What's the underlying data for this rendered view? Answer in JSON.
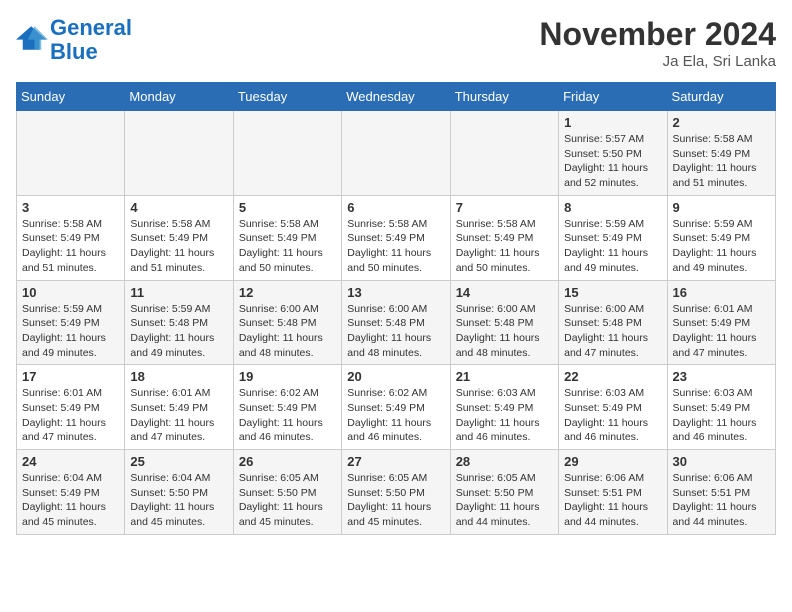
{
  "header": {
    "logo_line1": "General",
    "logo_line2": "Blue",
    "month": "November 2024",
    "location": "Ja Ela, Sri Lanka"
  },
  "weekdays": [
    "Sunday",
    "Monday",
    "Tuesday",
    "Wednesday",
    "Thursday",
    "Friday",
    "Saturday"
  ],
  "weeks": [
    [
      {
        "day": "",
        "info": ""
      },
      {
        "day": "",
        "info": ""
      },
      {
        "day": "",
        "info": ""
      },
      {
        "day": "",
        "info": ""
      },
      {
        "day": "",
        "info": ""
      },
      {
        "day": "1",
        "info": "Sunrise: 5:57 AM\nSunset: 5:50 PM\nDaylight: 11 hours and 52 minutes."
      },
      {
        "day": "2",
        "info": "Sunrise: 5:58 AM\nSunset: 5:49 PM\nDaylight: 11 hours and 51 minutes."
      }
    ],
    [
      {
        "day": "3",
        "info": "Sunrise: 5:58 AM\nSunset: 5:49 PM\nDaylight: 11 hours and 51 minutes."
      },
      {
        "day": "4",
        "info": "Sunrise: 5:58 AM\nSunset: 5:49 PM\nDaylight: 11 hours and 51 minutes."
      },
      {
        "day": "5",
        "info": "Sunrise: 5:58 AM\nSunset: 5:49 PM\nDaylight: 11 hours and 50 minutes."
      },
      {
        "day": "6",
        "info": "Sunrise: 5:58 AM\nSunset: 5:49 PM\nDaylight: 11 hours and 50 minutes."
      },
      {
        "day": "7",
        "info": "Sunrise: 5:58 AM\nSunset: 5:49 PM\nDaylight: 11 hours and 50 minutes."
      },
      {
        "day": "8",
        "info": "Sunrise: 5:59 AM\nSunset: 5:49 PM\nDaylight: 11 hours and 49 minutes."
      },
      {
        "day": "9",
        "info": "Sunrise: 5:59 AM\nSunset: 5:49 PM\nDaylight: 11 hours and 49 minutes."
      }
    ],
    [
      {
        "day": "10",
        "info": "Sunrise: 5:59 AM\nSunset: 5:49 PM\nDaylight: 11 hours and 49 minutes."
      },
      {
        "day": "11",
        "info": "Sunrise: 5:59 AM\nSunset: 5:48 PM\nDaylight: 11 hours and 49 minutes."
      },
      {
        "day": "12",
        "info": "Sunrise: 6:00 AM\nSunset: 5:48 PM\nDaylight: 11 hours and 48 minutes."
      },
      {
        "day": "13",
        "info": "Sunrise: 6:00 AM\nSunset: 5:48 PM\nDaylight: 11 hours and 48 minutes."
      },
      {
        "day": "14",
        "info": "Sunrise: 6:00 AM\nSunset: 5:48 PM\nDaylight: 11 hours and 48 minutes."
      },
      {
        "day": "15",
        "info": "Sunrise: 6:00 AM\nSunset: 5:48 PM\nDaylight: 11 hours and 47 minutes."
      },
      {
        "day": "16",
        "info": "Sunrise: 6:01 AM\nSunset: 5:49 PM\nDaylight: 11 hours and 47 minutes."
      }
    ],
    [
      {
        "day": "17",
        "info": "Sunrise: 6:01 AM\nSunset: 5:49 PM\nDaylight: 11 hours and 47 minutes."
      },
      {
        "day": "18",
        "info": "Sunrise: 6:01 AM\nSunset: 5:49 PM\nDaylight: 11 hours and 47 minutes."
      },
      {
        "day": "19",
        "info": "Sunrise: 6:02 AM\nSunset: 5:49 PM\nDaylight: 11 hours and 46 minutes."
      },
      {
        "day": "20",
        "info": "Sunrise: 6:02 AM\nSunset: 5:49 PM\nDaylight: 11 hours and 46 minutes."
      },
      {
        "day": "21",
        "info": "Sunrise: 6:03 AM\nSunset: 5:49 PM\nDaylight: 11 hours and 46 minutes."
      },
      {
        "day": "22",
        "info": "Sunrise: 6:03 AM\nSunset: 5:49 PM\nDaylight: 11 hours and 46 minutes."
      },
      {
        "day": "23",
        "info": "Sunrise: 6:03 AM\nSunset: 5:49 PM\nDaylight: 11 hours and 46 minutes."
      }
    ],
    [
      {
        "day": "24",
        "info": "Sunrise: 6:04 AM\nSunset: 5:49 PM\nDaylight: 11 hours and 45 minutes."
      },
      {
        "day": "25",
        "info": "Sunrise: 6:04 AM\nSunset: 5:50 PM\nDaylight: 11 hours and 45 minutes."
      },
      {
        "day": "26",
        "info": "Sunrise: 6:05 AM\nSunset: 5:50 PM\nDaylight: 11 hours and 45 minutes."
      },
      {
        "day": "27",
        "info": "Sunrise: 6:05 AM\nSunset: 5:50 PM\nDaylight: 11 hours and 45 minutes."
      },
      {
        "day": "28",
        "info": "Sunrise: 6:05 AM\nSunset: 5:50 PM\nDaylight: 11 hours and 44 minutes."
      },
      {
        "day": "29",
        "info": "Sunrise: 6:06 AM\nSunset: 5:51 PM\nDaylight: 11 hours and 44 minutes."
      },
      {
        "day": "30",
        "info": "Sunrise: 6:06 AM\nSunset: 5:51 PM\nDaylight: 11 hours and 44 minutes."
      }
    ]
  ]
}
